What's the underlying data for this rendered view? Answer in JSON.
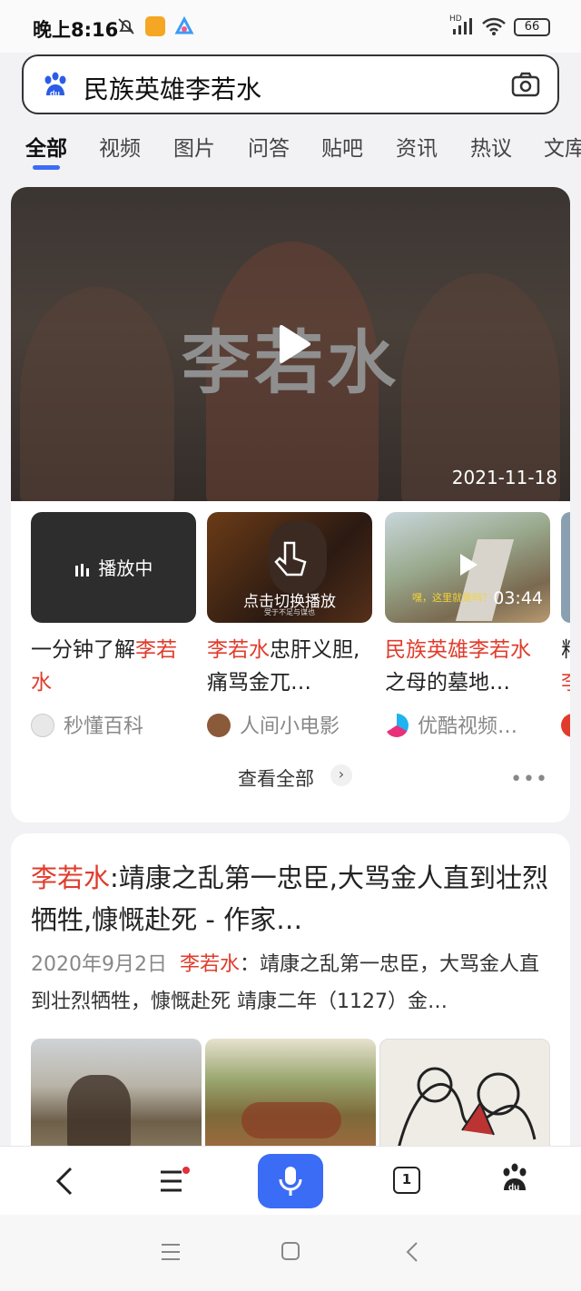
{
  "status": {
    "time": "晚上8:16",
    "battery": "66",
    "network": "HD"
  },
  "search": {
    "query": "民族英雄李若水"
  },
  "tabs": [
    "全部",
    "视频",
    "图片",
    "问答",
    "贴吧",
    "资讯",
    "热议",
    "文库"
  ],
  "video": {
    "title": "李若水",
    "date": "2021-11-18",
    "items": [
      {
        "badge": "播放中",
        "title_hl": "",
        "title_prefix": "一分钟了解",
        "title_hl2": "李若水",
        "title_rest": "",
        "source": "秒懂百科"
      },
      {
        "badge": "点击切换播放",
        "subtitle": "受于不足与谋也",
        "title_hl": "李若水",
        "title_rest": "忠肝义胆,痛骂金兀…",
        "source": "人间小电影"
      },
      {
        "duration": "03:44",
        "title_hl": "民族英雄李若水",
        "title_rest": "之母的墓地…",
        "source": "优酷视频…",
        "caption": "嘿，这里就是吗？"
      }
    ],
    "see_all": "查看全部"
  },
  "article": {
    "title_hl": "李若水",
    "title_rest": ":靖康之乱第一忠臣,大骂金人直到壮烈牺牲,慷慨赴死 - 作家…",
    "date": "2020年9月2日",
    "snippet_hl": "李若水",
    "snippet_rest": "：靖康之乱第一忠臣，大骂金人直到壮烈牺牲，慷慨赴死 靖康二年（1127）金…"
  },
  "bottom": {
    "tab_count": "1"
  },
  "colors": {
    "accent": "#3b6cf6",
    "highlight": "#e03c2c"
  }
}
